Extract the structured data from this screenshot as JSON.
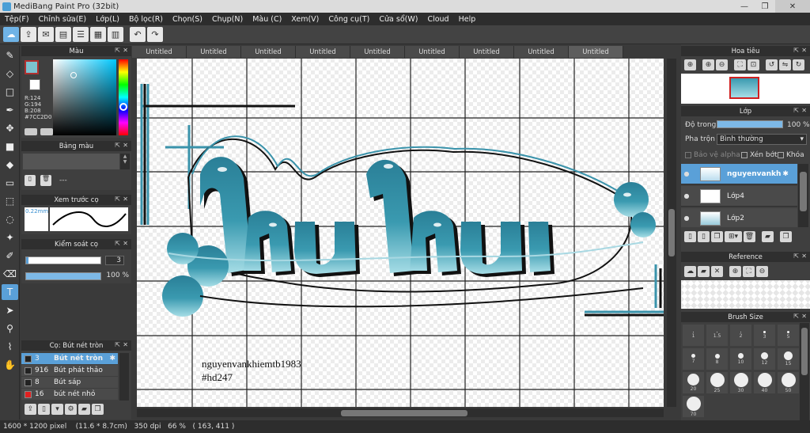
{
  "app": {
    "title": "MediBang Paint Pro (32bit)"
  },
  "window": {
    "minimize": "—",
    "restore": "❐",
    "close": "✕"
  },
  "menu": [
    "Tệp(F)",
    "Chỉnh sửa(E)",
    "Lớp(L)",
    "Bộ lọc(R)",
    "Chọn(S)",
    "Chụp(N)",
    "Màu (C)",
    "Xem(V)",
    "Công cụ(T)",
    "Cửa sổ(W)",
    "Cloud",
    "Help"
  ],
  "tabs": [
    "Untitled",
    "Untitled",
    "Untitled",
    "Untitled",
    "Untitled",
    "Untitled",
    "Untitled",
    "Untitled",
    "Untitled"
  ],
  "color_panel": {
    "title": "Màu",
    "r": "R:124",
    "g": "G:194",
    "b": "B:208",
    "hex": "#7CC2D0",
    "current": "#7CC2D0"
  },
  "palette_panel": {
    "title": "Bảng màu",
    "placeholder": "---"
  },
  "preview_panel": {
    "title": "Xem trước cọ",
    "size": "0.22mm"
  },
  "control_panel": {
    "title": "Kiểm soát cọ",
    "size_value": "3",
    "opacity_value": "100 %",
    "opacity_fraction": 1
  },
  "brush_panel": {
    "title": "Cọ: Bút nét tròn",
    "items": [
      {
        "size": "3",
        "name": "Bút nét tròn",
        "color": "#222222",
        "selected": true
      },
      {
        "size": "916",
        "name": "Bút phát thảo",
        "color": "#222222",
        "selected": false
      },
      {
        "size": "8",
        "name": "Bút sáp",
        "color": "#222222",
        "selected": false
      },
      {
        "size": "16",
        "name": "bút nét nhỏ",
        "color": "#e02020",
        "selected": false
      }
    ]
  },
  "navigator_panel": {
    "title": "Hoa tiêu"
  },
  "layer_panel": {
    "title": "Lớp",
    "opacity_label": "Độ trong",
    "opacity_value": "100 %",
    "opacity_fraction": 1,
    "blend_label": "Pha trộn",
    "blend_value": "Bình thường",
    "protect_alpha": "Bảo vệ alpha",
    "clipping": "Xén bớt",
    "lock": "Khóa",
    "layers": [
      {
        "name": "nguyenvankh",
        "selected": true
      },
      {
        "name": "Lớp4",
        "selected": false
      },
      {
        "name": "Lớp2",
        "selected": false
      }
    ]
  },
  "reference_panel": {
    "title": "Reference"
  },
  "brush_size_panel": {
    "title": "Brush Size",
    "sizes": [
      "1",
      "1.5",
      "2",
      "3",
      "5",
      "7",
      "8",
      "10",
      "12",
      "15",
      "20",
      "25",
      "30",
      "40",
      "50",
      "70"
    ]
  },
  "canvas": {
    "art_text": "huhu",
    "signature_line1": "nguyenvankhiemtb1983",
    "signature_line2": "#hd247"
  },
  "status": {
    "text": "1600 * 1200 pixel    (11.6 * 8.7cm)   350 dpi   66 %   ( 163, 411 )"
  },
  "colors": {
    "accent": "#5aa0d8",
    "art_fill_top": "#2f8fa6",
    "art_fill_bottom": "#8fd4e0",
    "art_outline": "#111111"
  }
}
